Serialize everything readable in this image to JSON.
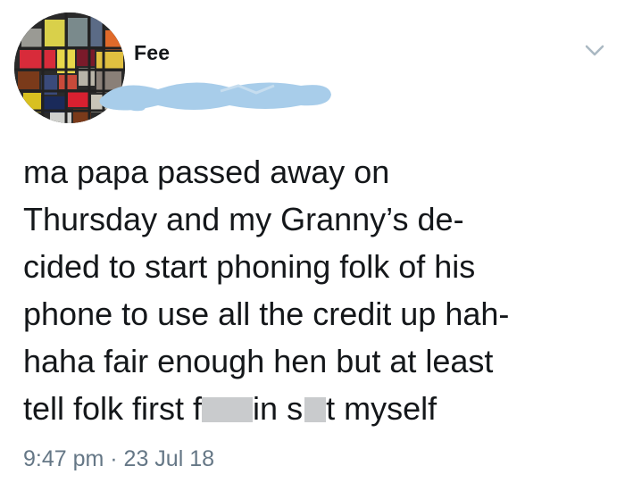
{
  "tweet": {
    "display_name": "Fee",
    "text_lines": [
      "ma papa passed away on",
      "Thursday and my Granny’s de-",
      "cided to start phoning folk of his",
      "phone to use all the credit up hah-",
      "haha fair enough hen but at least"
    ],
    "last_line": {
      "part1": "tell folk first f",
      "part2": "in s",
      "part3": "t myself"
    },
    "timestamp": "9:47 pm · 23 Jul 18"
  },
  "icons": {
    "menu": "chevron-down-icon"
  },
  "colors": {
    "text": "#14171a",
    "secondary_text": "#657786",
    "redaction": "#a8cdea",
    "censor": "#c9cbcd"
  }
}
